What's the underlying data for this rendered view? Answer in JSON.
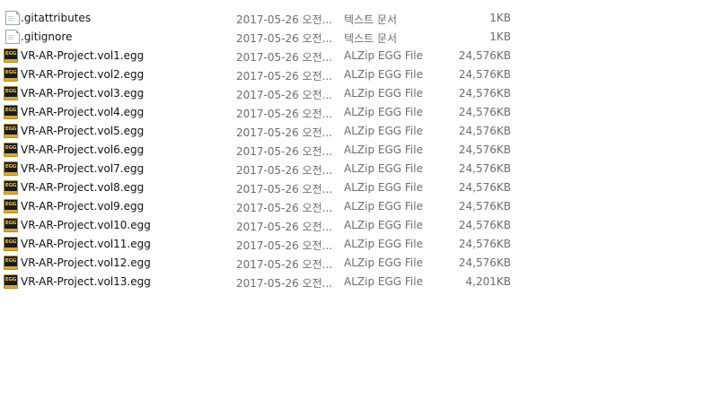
{
  "files": [
    {
      "name": ".gitattributes",
      "date": "2017-05-26 오전...",
      "type": "텍스트 문서",
      "size": "1KB",
      "icon": "text-document-icon"
    },
    {
      "name": ".gitignore",
      "date": "2017-05-26 오전...",
      "type": "텍스트 문서",
      "size": "1KB",
      "icon": "text-document-icon"
    },
    {
      "name": "VR-AR-Project.vol1.egg",
      "date": "2017-05-26 오전...",
      "type": "ALZip EGG File",
      "size": "24,576KB",
      "icon": "egg-archive-icon"
    },
    {
      "name": "VR-AR-Project.vol2.egg",
      "date": "2017-05-26 오전...",
      "type": "ALZip EGG File",
      "size": "24,576KB",
      "icon": "egg-archive-icon"
    },
    {
      "name": "VR-AR-Project.vol3.egg",
      "date": "2017-05-26 오전...",
      "type": "ALZip EGG File",
      "size": "24,576KB",
      "icon": "egg-archive-icon"
    },
    {
      "name": "VR-AR-Project.vol4.egg",
      "date": "2017-05-26 오전...",
      "type": "ALZip EGG File",
      "size": "24,576KB",
      "icon": "egg-archive-icon"
    },
    {
      "name": "VR-AR-Project.vol5.egg",
      "date": "2017-05-26 오전...",
      "type": "ALZip EGG File",
      "size": "24,576KB",
      "icon": "egg-archive-icon"
    },
    {
      "name": "VR-AR-Project.vol6.egg",
      "date": "2017-05-26 오전...",
      "type": "ALZip EGG File",
      "size": "24,576KB",
      "icon": "egg-archive-icon"
    },
    {
      "name": "VR-AR-Project.vol7.egg",
      "date": "2017-05-26 오전...",
      "type": "ALZip EGG File",
      "size": "24,576KB",
      "icon": "egg-archive-icon"
    },
    {
      "name": "VR-AR-Project.vol8.egg",
      "date": "2017-05-26 오전...",
      "type": "ALZip EGG File",
      "size": "24,576KB",
      "icon": "egg-archive-icon"
    },
    {
      "name": "VR-AR-Project.vol9.egg",
      "date": "2017-05-26 오전...",
      "type": "ALZip EGG File",
      "size": "24,576KB",
      "icon": "egg-archive-icon"
    },
    {
      "name": "VR-AR-Project.vol10.egg",
      "date": "2017-05-26 오전...",
      "type": "ALZip EGG File",
      "size": "24,576KB",
      "icon": "egg-archive-icon"
    },
    {
      "name": "VR-AR-Project.vol11.egg",
      "date": "2017-05-26 오전...",
      "type": "ALZip EGG File",
      "size": "24,576KB",
      "icon": "egg-archive-icon"
    },
    {
      "name": "VR-AR-Project.vol12.egg",
      "date": "2017-05-26 오전...",
      "type": "ALZip EGG File",
      "size": "24,576KB",
      "icon": "egg-archive-icon"
    },
    {
      "name": "VR-AR-Project.vol13.egg",
      "date": "2017-05-26 오전...",
      "type": "ALZip EGG File",
      "size": "4,201KB",
      "icon": "egg-archive-icon"
    }
  ]
}
